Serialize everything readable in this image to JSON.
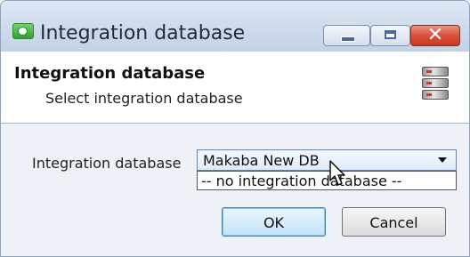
{
  "window": {
    "title": "Integration database"
  },
  "header": {
    "title": "Integration database",
    "subtitle": "Select integration database",
    "icon": "database-server-icon"
  },
  "form": {
    "label": "Integration database",
    "selected_value": "Makaba New DB",
    "options": [
      "-- no integration database --"
    ]
  },
  "buttons": {
    "ok": "OK",
    "cancel": "Cancel"
  },
  "colors": {
    "titlebar": "#cddbeb",
    "close_button": "#d8503a",
    "ok_button_accent": "#3c7fb1",
    "dialog_body": "#eef1f5"
  }
}
